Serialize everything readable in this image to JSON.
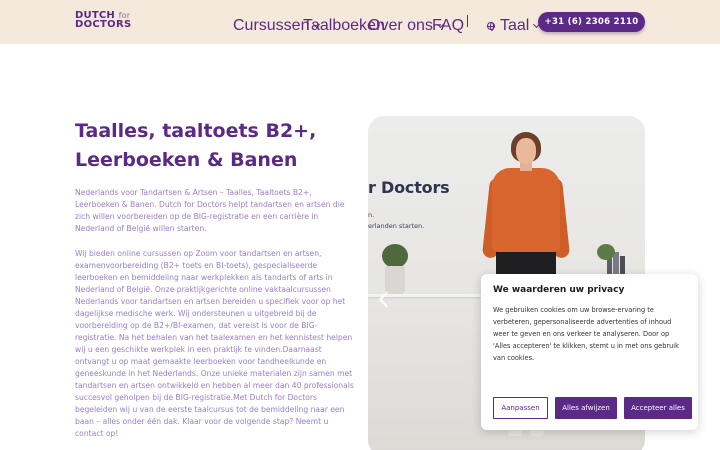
{
  "header": {
    "logo": {
      "line1": "DUTCH",
      "line1_small": "for",
      "line2": "DOCTORS"
    },
    "nav": [
      {
        "label": "Cursussen",
        "dropdown": true
      },
      {
        "label": "Taalboeken",
        "dropdown": false
      },
      {
        "label": "Over ons",
        "dropdown": true
      },
      {
        "label": "FAQ",
        "dropdown": false
      }
    ],
    "language": {
      "label": "Taal",
      "icon": "globe-icon"
    },
    "phone": "+31 (6) 2306 2110"
  },
  "main": {
    "title": "Taalles, taaltoets B2+, Leerboeken & Banen",
    "paragraph1": "Nederlands voor Tandartsen & Artsen – Taalles, Taaltoets B2+, Leerboeken & Banen. Dutch for Doctors helpt tandartsen en artsen die zich willen voorbereiden op de BIG-registratie en een carrière in Nederland of België willen starten.",
    "paragraph2": "Wij bieden online cursussen op Zoom voor tandartsen en artsen, examenvoorbereiding (B2+ toets en BI-toets), gespecialiseerde leerboeken en bemiddeling naar werkplekken als tandarts of arts in Nederland of België. Onze praktijkgerichte online vaktaalcursussen Nederlands voor tandartsen en artsen bereiden u specifiek voor op het dagelijkse medische werk. Wij ondersteunen u uitgebreid bij de voorbereiding op de B2+/BI-examen, dat vereist is voor de BIG-registratie. Na het behalen van het taalexamen en het kennistest helpen wij u een geschikte werkplek in een praktijk te vinden.Daarnaast ontvangt u op maat gemaakte leerboeken voor tandheelkunde en geneeskunde in het Nederlands. Onze unieke materialen zijn samen met tandartsen en artsen ontwikkeld en hebben al meer dan 40 professionals succesvol geholpen bij de BIG-registratie.Met Dutch for Doctors begeleiden wij u van de eerste taalcursus tot de bemiddeling naar een baan – alles onder één dak. Klaar voor de volgende stap? Neemt u contact op!"
  },
  "hero": {
    "sign_text": "r Doctors",
    "sign_sub1": "n.",
    "sign_sub2": "erlanden starten."
  },
  "cookie_banner": {
    "title": "We waarderen uw privacy",
    "text": "We gebruiken cookies om uw browse-ervaring te verbeteren, gepersonaliseerde advertenties of inhoud weer te geven en ons verkeer te analyseren. Door op 'Alles accepteren' te klikken, stemt u in met ons gebruik van cookies.",
    "customize": "Aanpassen",
    "reject": "Alles afwijzen",
    "accept": "Accepteer alles"
  },
  "colors": {
    "brand": "#5b2a86",
    "header_bg": "#f5e9db",
    "body_text": "#9b7ec4"
  }
}
